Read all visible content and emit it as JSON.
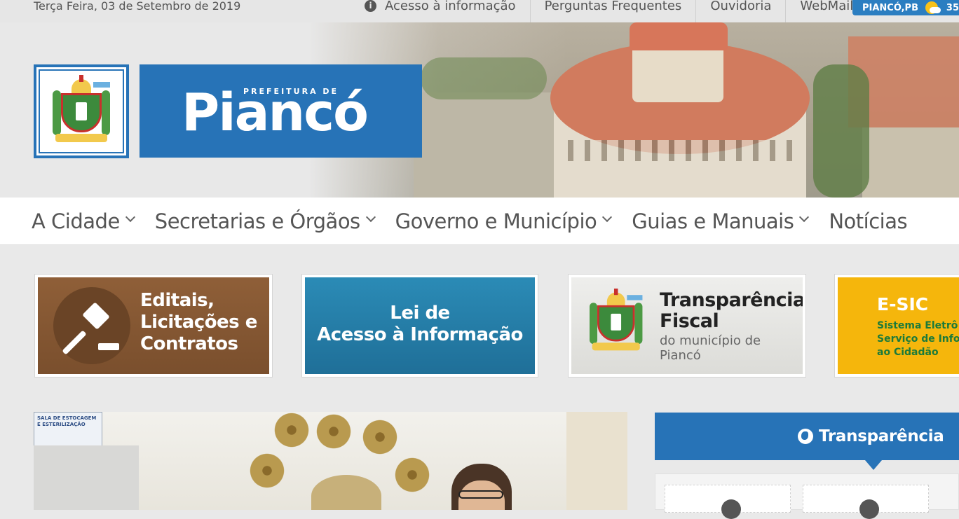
{
  "topbar": {
    "date": "Terça Feira, 03 de Setembro de 2019",
    "links": [
      "Acesso à informação",
      "Perguntas Frequentes",
      "Ouvidoria",
      "WebMail"
    ],
    "weather": {
      "location": "PIANCÓ,PB",
      "temp": "35"
    }
  },
  "header": {
    "prefix": "PREFEITURA DE",
    "city": "Piancó"
  },
  "nav": {
    "items": [
      "A Cidade",
      "Secretarias e Órgãos",
      "Governo e Município",
      "Guias e Manuais",
      "Notícias"
    ]
  },
  "cards": {
    "editais": [
      "Editais,",
      "Licitações e",
      "Contratos"
    ],
    "lai": [
      "Lei de",
      "Acesso à Informação"
    ],
    "transparencia_fiscal": {
      "title_1": "Transparência",
      "title_2": "Fiscal",
      "sub_1": "do município de",
      "sub_2": "Piancó"
    },
    "esic": {
      "title": "E-SIC",
      "lines": [
        "Sistema Eletrô",
        "Serviço de Info",
        "ao Cidadão"
      ]
    }
  },
  "photo": {
    "sign_text": "SALA DE ESTOCAGEM E ESTERILIZAÇÃO"
  },
  "sidebar": {
    "transparencia_label": "Transparência"
  },
  "colors": {
    "brand_blue": "#2773b7",
    "editais_brown": "#7a4f2d",
    "lai_teal": "#1f6f98",
    "esic_yellow": "#f5b60c"
  }
}
